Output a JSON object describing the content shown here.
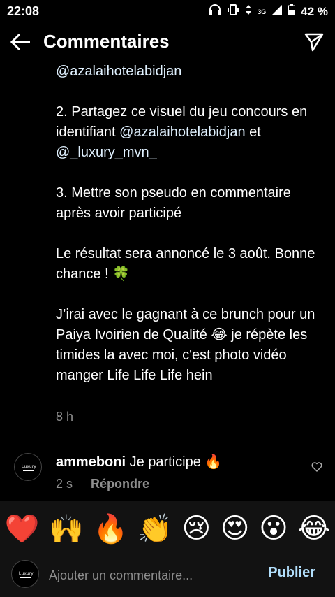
{
  "status": {
    "time": "22:08",
    "network": "3G",
    "battery": "42 %",
    "icons": [
      "headphones-icon",
      "vibrate-icon",
      "data-arrows-icon",
      "wifi-icon",
      "signal-icon",
      "battery-icon"
    ]
  },
  "header": {
    "title": "Commentaires",
    "back_icon": "arrow-left-icon",
    "send_icon": "send-icon"
  },
  "caption": {
    "line1_mention": "@azalaihotelabidjan",
    "step2_prefix": "2. Partagez ce visuel du jeu concours en identifiant ",
    "step2_mention1": "@azalaihotelabidjan",
    "step2_and": " et ",
    "step2_mention2": "@_luxury_mvn_",
    "step3": "3. Mettre son pseudo en commentaire après avoir participé",
    "result": "Le résultat sera annoncé le 3 août. Bonne chance ! 🍀",
    "closing": "J’irai avec le gagnant à ce brunch pour un Paiya Ivoirien de Qualité 😂 je répète les timides la avec moi, c'est photo vidéo manger Life Life Life hein",
    "time": "8 h"
  },
  "comment": {
    "username": "ammeboni",
    "text": "Je participe 🔥",
    "time": "2 s",
    "reply_label": "Répondre",
    "avatar_text": "Luxury"
  },
  "emojis": [
    "❤️",
    "🙌",
    "🔥",
    "👏",
    "😢",
    "😍",
    "😮",
    "😂"
  ],
  "input": {
    "placeholder": "Ajouter un commentaire...",
    "publish_label": "Publier"
  }
}
